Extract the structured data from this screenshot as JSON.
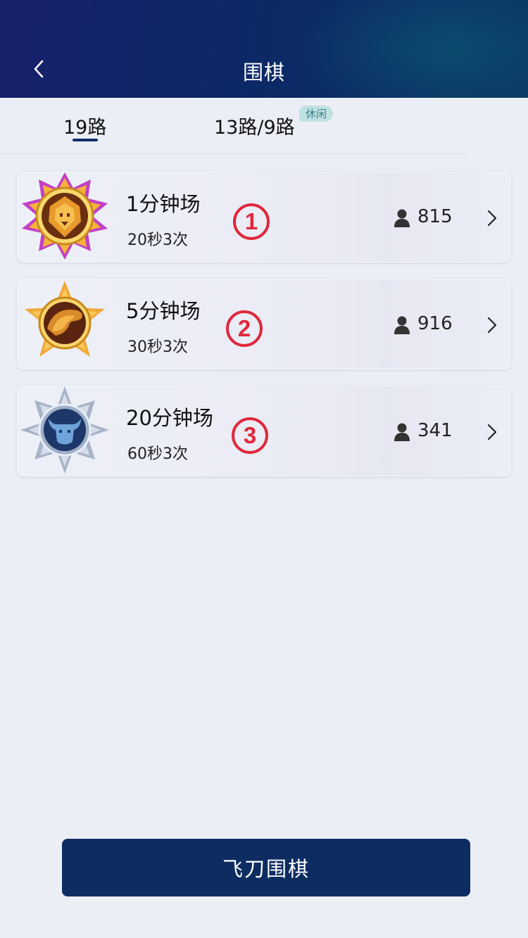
{
  "header": {
    "title": "围棋",
    "back_icon": "chevron-left-icon"
  },
  "tabs": [
    {
      "label": "19路",
      "active": true
    },
    {
      "label": "13路/9路",
      "badge": "休闲",
      "active": false
    }
  ],
  "rooms": [
    {
      "title": "1分钟场",
      "rule": "20秒3次",
      "players": "815",
      "marker": "1",
      "badge_icon": "lion-medal-icon"
    },
    {
      "title": "5分钟场",
      "rule": "30秒3次",
      "players": "916",
      "marker": "2",
      "badge_icon": "panther-medal-icon"
    },
    {
      "title": "20分钟场",
      "rule": "60秒3次",
      "players": "341",
      "marker": "3",
      "badge_icon": "bull-medal-icon"
    }
  ],
  "bottom_button": {
    "label": "飞刀围棋"
  },
  "colors": {
    "header": "#17206b",
    "accent": "#0d2d62",
    "marker": "#e0283c"
  }
}
